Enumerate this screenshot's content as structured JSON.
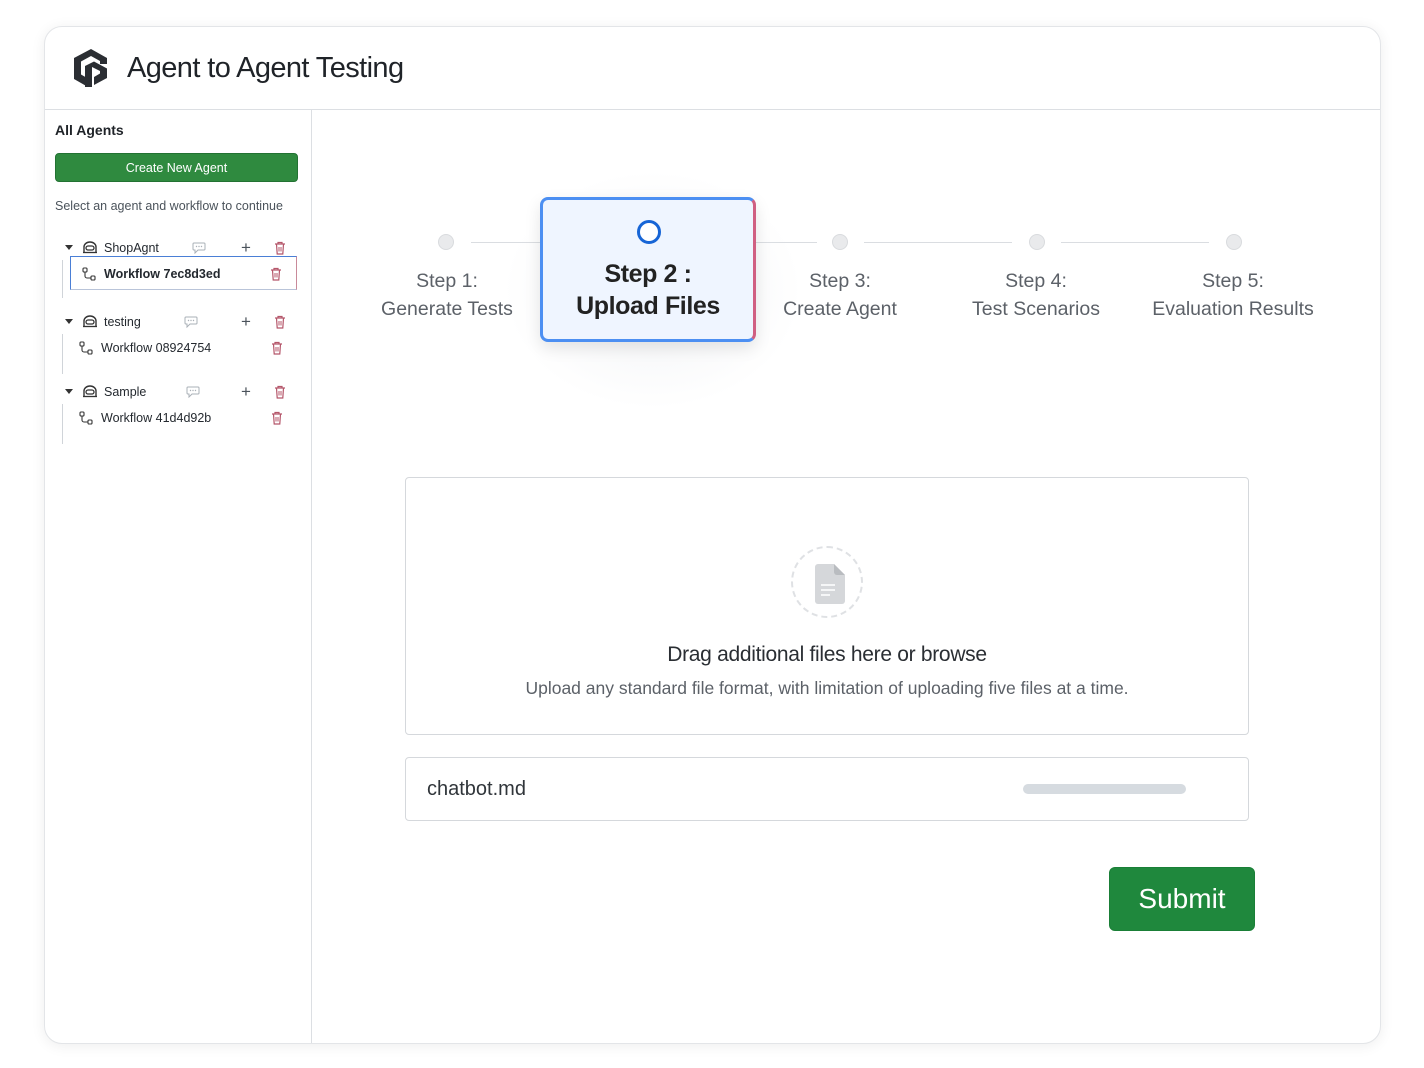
{
  "header": {
    "title": "Agent to Agent Testing",
    "logo_icon": "logo-icon"
  },
  "sidebar": {
    "heading": "All Agents",
    "create_button": "Create New Agent",
    "hint": "Select an agent and workflow to continue",
    "agents": [
      {
        "name": "ShopAgnt",
        "workflows": [
          {
            "name": "Workflow 7ec8d3ed",
            "selected": true
          }
        ]
      },
      {
        "name": "testing",
        "workflows": [
          {
            "name": "Workflow 08924754",
            "selected": false
          }
        ]
      },
      {
        "name": "Sample",
        "workflows": [
          {
            "name": "Workflow 41d4d92b",
            "selected": false
          }
        ]
      }
    ]
  },
  "stepper": {
    "steps": [
      {
        "line1": "Step 1:",
        "line2": "Generate Tests",
        "active": false
      },
      {
        "line1": "Step 2 :",
        "line2": "Upload Files",
        "active": true
      },
      {
        "line1": "Step 3:",
        "line2": "Create Agent",
        "active": false
      },
      {
        "line1": "Step 4:",
        "line2": "Test Scenarios",
        "active": false
      },
      {
        "line1": "Step 5:",
        "line2": "Evaluation Results",
        "active": false
      }
    ]
  },
  "upload": {
    "title": "Drag additional files here or browse",
    "subtitle": "Upload any standard file format, with limitation of uploading five files at a time.",
    "icon": "file-icon",
    "files": [
      {
        "name": "chatbot.md",
        "progress": 1.0
      }
    ]
  },
  "actions": {
    "submit": "Submit"
  },
  "colors": {
    "primary_green": "#1f883d",
    "sidebar_green": "#2f8a3f",
    "active_blue": "#1765d6",
    "trash_red": "#b5566a"
  }
}
